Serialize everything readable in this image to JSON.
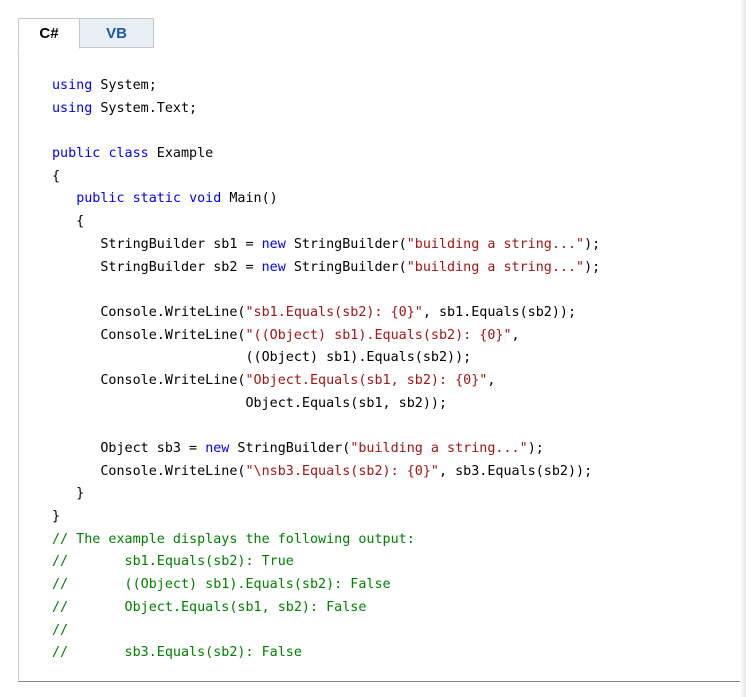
{
  "tabs": [
    {
      "label": "C#",
      "active": true
    },
    {
      "label": "VB",
      "active": false
    }
  ],
  "colors": {
    "keyword": "#0000ff",
    "string": "#a31515",
    "comment": "#008000",
    "tab_link": "#1c5aa8"
  },
  "code": [
    [
      {
        "t": "kw",
        "v": "using"
      },
      {
        "t": "tx",
        "v": " System;"
      }
    ],
    [
      {
        "t": "kw",
        "v": "using"
      },
      {
        "t": "tx",
        "v": " System.Text;"
      }
    ],
    [],
    [
      {
        "t": "kw",
        "v": "public"
      },
      {
        "t": "tx",
        "v": " "
      },
      {
        "t": "kw",
        "v": "class"
      },
      {
        "t": "tx",
        "v": " Example"
      }
    ],
    [
      {
        "t": "tx",
        "v": "{"
      }
    ],
    [
      {
        "t": "tx",
        "v": "   "
      },
      {
        "t": "kw",
        "v": "public"
      },
      {
        "t": "tx",
        "v": " "
      },
      {
        "t": "kw",
        "v": "static"
      },
      {
        "t": "tx",
        "v": " "
      },
      {
        "t": "kw",
        "v": "void"
      },
      {
        "t": "tx",
        "v": " Main()"
      }
    ],
    [
      {
        "t": "tx",
        "v": "   {"
      }
    ],
    [
      {
        "t": "tx",
        "v": "      StringBuilder sb1 = "
      },
      {
        "t": "kw",
        "v": "new"
      },
      {
        "t": "tx",
        "v": " StringBuilder("
      },
      {
        "t": "str",
        "v": "\"building a string...\""
      },
      {
        "t": "tx",
        "v": ");"
      }
    ],
    [
      {
        "t": "tx",
        "v": "      StringBuilder sb2 = "
      },
      {
        "t": "kw",
        "v": "new"
      },
      {
        "t": "tx",
        "v": " StringBuilder("
      },
      {
        "t": "str",
        "v": "\"building a string...\""
      },
      {
        "t": "tx",
        "v": ");"
      }
    ],
    [],
    [
      {
        "t": "tx",
        "v": "      Console.WriteLine("
      },
      {
        "t": "str",
        "v": "\"sb1.Equals(sb2): {0}\""
      },
      {
        "t": "tx",
        "v": ", sb1.Equals(sb2));"
      }
    ],
    [
      {
        "t": "tx",
        "v": "      Console.WriteLine("
      },
      {
        "t": "str",
        "v": "\"((Object) sb1).Equals(sb2): {0}\""
      },
      {
        "t": "tx",
        "v": ","
      }
    ],
    [
      {
        "t": "tx",
        "v": "                        ((Object) sb1).Equals(sb2));"
      }
    ],
    [
      {
        "t": "tx",
        "v": "      Console.WriteLine("
      },
      {
        "t": "str",
        "v": "\"Object.Equals(sb1, sb2): {0}\""
      },
      {
        "t": "tx",
        "v": ","
      }
    ],
    [
      {
        "t": "tx",
        "v": "                        Object.Equals(sb1, sb2));"
      }
    ],
    [],
    [
      {
        "t": "tx",
        "v": "      Object sb3 = "
      },
      {
        "t": "kw",
        "v": "new"
      },
      {
        "t": "tx",
        "v": " StringBuilder("
      },
      {
        "t": "str",
        "v": "\"building a string...\""
      },
      {
        "t": "tx",
        "v": ");"
      }
    ],
    [
      {
        "t": "tx",
        "v": "      Console.WriteLine("
      },
      {
        "t": "str",
        "v": "\"\\nsb3.Equals(sb2): {0}\""
      },
      {
        "t": "tx",
        "v": ", sb3.Equals(sb2));"
      }
    ],
    [
      {
        "t": "tx",
        "v": "   }"
      }
    ],
    [
      {
        "t": "tx",
        "v": "}"
      }
    ],
    [
      {
        "t": "cm",
        "v": "// The example displays the following output:"
      }
    ],
    [
      {
        "t": "cm",
        "v": "//       sb1.Equals(sb2): True"
      }
    ],
    [
      {
        "t": "cm",
        "v": "//       ((Object) sb1).Equals(sb2): False"
      }
    ],
    [
      {
        "t": "cm",
        "v": "//       Object.Equals(sb1, sb2): False"
      }
    ],
    [
      {
        "t": "cm",
        "v": "//"
      }
    ],
    [
      {
        "t": "cm",
        "v": "//       sb3.Equals(sb2): False"
      }
    ]
  ]
}
